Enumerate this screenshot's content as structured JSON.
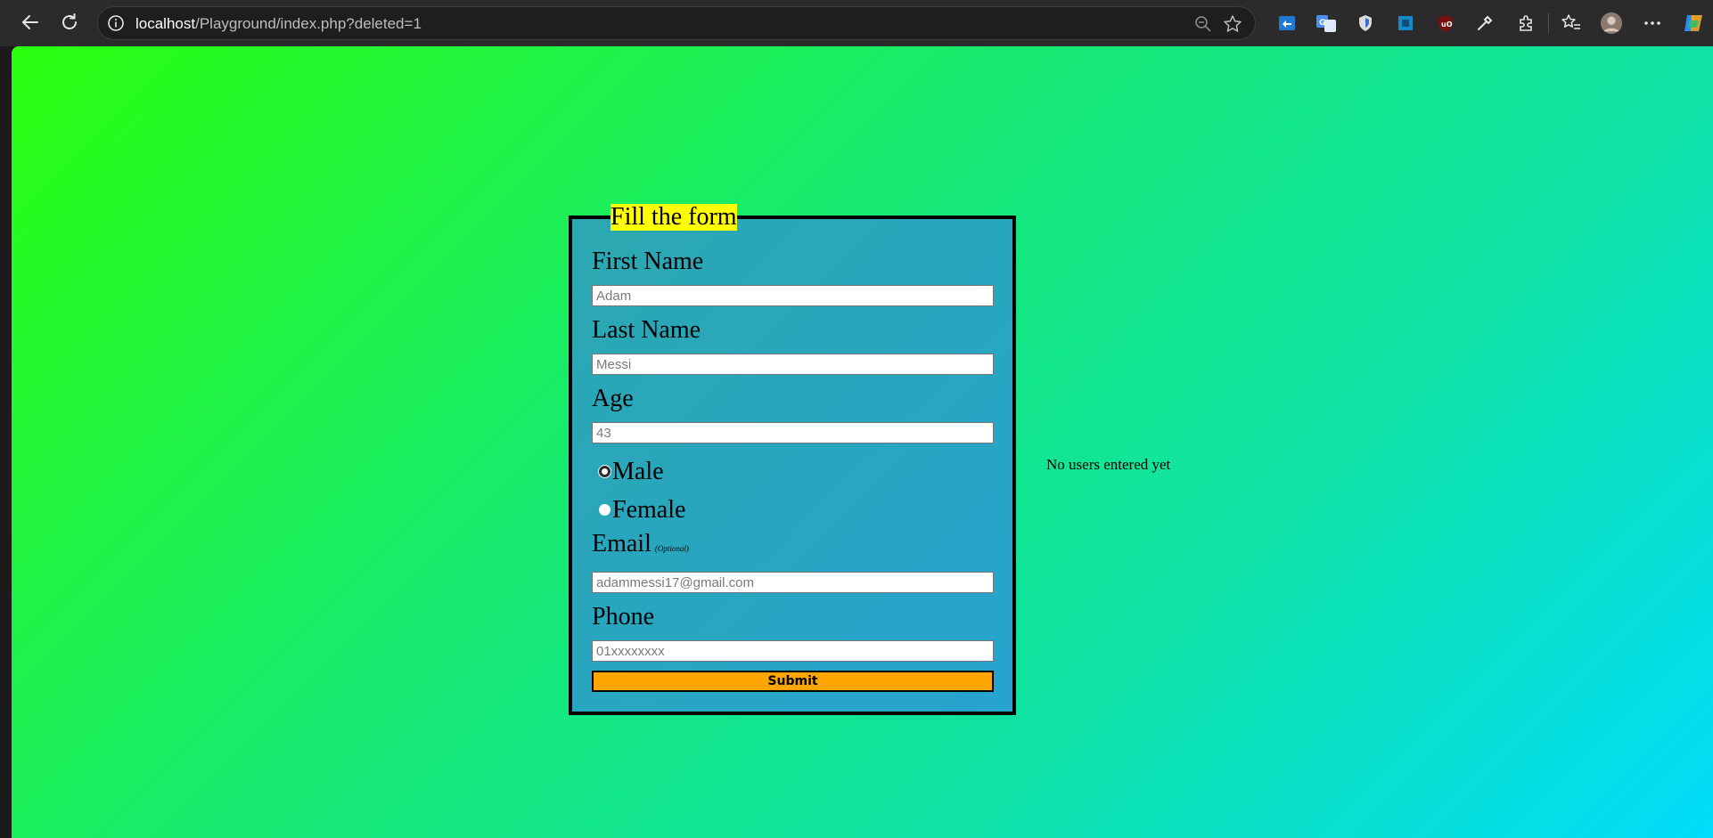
{
  "browser": {
    "url_host": "localhost",
    "url_path": "/Playground/index.php?deleted=1"
  },
  "form": {
    "legend": "Fill the form",
    "first_name": {
      "label": "First Name",
      "placeholder": "Adam"
    },
    "last_name": {
      "label": "Last Name",
      "placeholder": "Messi"
    },
    "age": {
      "label": "Age",
      "placeholder": "43"
    },
    "gender": {
      "options": [
        "Male",
        "Female"
      ]
    },
    "email": {
      "label": "Email",
      "optional_note": "(Optional)",
      "placeholder": "adammessi17@gmail.com"
    },
    "phone": {
      "label": "Phone",
      "placeholder": "01xxxxxxxx"
    },
    "submit_label": "Submit"
  },
  "users": {
    "empty_message": "No users entered yet"
  },
  "colors": {
    "legend_bg": "#ffff00",
    "submit_bg": "#ffa500",
    "form_bg": "#28a6bf",
    "page_gradient_start": "#2aff0e",
    "page_gradient_end": "#00dcfb"
  }
}
